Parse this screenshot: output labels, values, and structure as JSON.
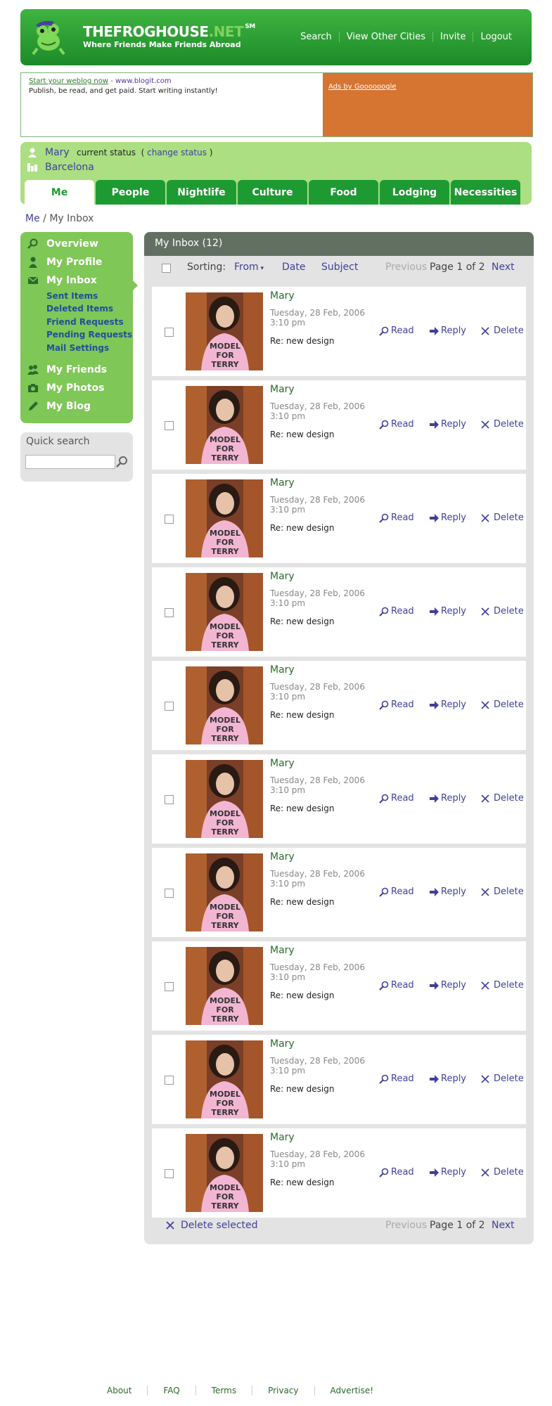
{
  "header": {
    "site_name": "THEFROGHOUSE",
    "site_name_suffix": ".NET",
    "trademark": "SM",
    "tagline": "Where Friends Make Friends Abroad",
    "nav": [
      "Search",
      "View Other Cities",
      "Invite",
      "Logout"
    ]
  },
  "ads": {
    "link_text": "Start your weblog now",
    "url_text": "- www.blogit.com",
    "body": "Publish, be read, and get paid. Start writing instantly!",
    "ads_by": "Ads by Goooooogle",
    "right_color": "#d67432"
  },
  "userbar": {
    "name": "Mary",
    "status_label": "current status",
    "change_status": "change status",
    "city": "Barcelona",
    "tabs": [
      "Me",
      "People",
      "Nightlife",
      "Culture",
      "Food",
      "Lodging",
      "Necessities"
    ],
    "active_tab": "Me"
  },
  "breadcrumb": {
    "root": "Me",
    "sep": "/",
    "current": "My Inbox"
  },
  "sidebar": {
    "items": [
      "Overview",
      "My Profile",
      "My Inbox",
      "My Friends",
      "My Photos",
      "My Blog"
    ],
    "inbox_sub": [
      "Sent Items",
      "Deleted Items",
      "Friend Requests",
      "Pending Requests",
      "Mail Settings"
    ],
    "quick_search": "Quick search"
  },
  "inbox": {
    "title": "My Inbox (12)",
    "sorting_label": "Sorting:",
    "sort_from": "From",
    "sort_date": "Date",
    "sort_subject": "Subject",
    "prev": "Previous",
    "page_info": "Page 1 of 2",
    "next": "Next",
    "delete_selected": "Delete selected",
    "actions": {
      "read": "Read",
      "reply": "Reply",
      "delete": "Delete"
    },
    "messages": [
      {
        "from": "Mary",
        "date": "Tuesday, 28 Feb, 2006",
        "time": "3:10 pm",
        "subject": "Re: new design"
      },
      {
        "from": "Mary",
        "date": "Tuesday, 28 Feb, 2006",
        "time": "3:10 pm",
        "subject": "Re: new design"
      },
      {
        "from": "Mary",
        "date": "Tuesday, 28 Feb, 2006",
        "time": "3:10 pm",
        "subject": "Re: new design"
      },
      {
        "from": "Mary",
        "date": "Tuesday, 28 Feb, 2006",
        "time": "3:10 pm",
        "subject": "Re: new design"
      },
      {
        "from": "Mary",
        "date": "Tuesday, 28 Feb, 2006",
        "time": "3:10 pm",
        "subject": "Re: new design"
      },
      {
        "from": "Mary",
        "date": "Tuesday, 28 Feb, 2006",
        "time": "3:10 pm",
        "subject": "Re: new design"
      },
      {
        "from": "Mary",
        "date": "Tuesday, 28 Feb, 2006",
        "time": "3:10 pm",
        "subject": "Re: new design"
      },
      {
        "from": "Mary",
        "date": "Tuesday, 28 Feb, 2006",
        "time": "3:10 pm",
        "subject": "Re: new design"
      },
      {
        "from": "Mary",
        "date": "Tuesday, 28 Feb, 2006",
        "time": "3:10 pm",
        "subject": "Re: new design"
      },
      {
        "from": "Mary",
        "date": "Tuesday, 28 Feb, 2006",
        "time": "3:10 pm",
        "subject": "Re: new design"
      }
    ]
  },
  "photo_text": [
    "MODEL",
    "FOR",
    "TERRY"
  ],
  "footer": [
    "About",
    "FAQ",
    "Terms",
    "Privacy",
    "Advertise!"
  ]
}
